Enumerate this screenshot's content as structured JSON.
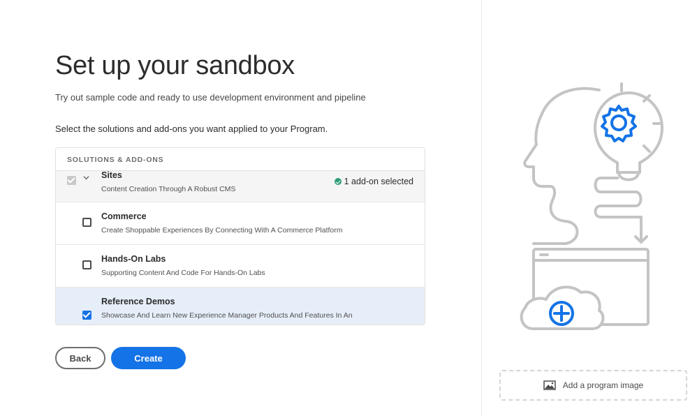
{
  "page": {
    "title": "Set up your sandbox",
    "subtitle": "Try out sample code and ready to use development environment and pipeline",
    "instruction": "Select the solutions and add-ons you want applied to your Program."
  },
  "panel": {
    "header": "SOLUTIONS & ADD-ONS",
    "sites": {
      "title": "Sites",
      "description": "Content Creation Through A Robust CMS",
      "status": "1 add-on selected",
      "checked": true
    },
    "addons": [
      {
        "title": "Commerce",
        "description": "Create Shoppable Experiences By Connecting With A Commerce Platform",
        "checked": false
      },
      {
        "title": "Hands-On Labs",
        "description": "Supporting Content And Code For Hands-On Labs",
        "checked": false
      },
      {
        "title": "Reference Demos",
        "description": "Showcase And Learn New Experience Manager Products And Features In An",
        "checked": true
      }
    ]
  },
  "buttons": {
    "back": "Back",
    "create": "Create"
  },
  "sidebar": {
    "add_image_label": "Add a program image",
    "illustration_icon": "head-lightbulb-gear-cloud-illustration"
  },
  "colors": {
    "accent": "#1473e6",
    "success": "#2d9d78",
    "selected_row": "#e6eef9"
  }
}
